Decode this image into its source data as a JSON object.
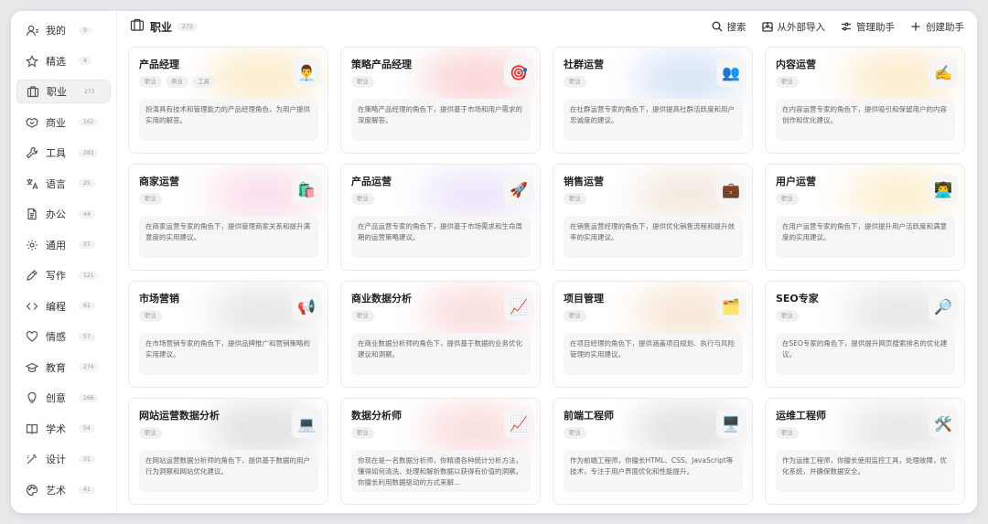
{
  "sidebar": {
    "items": [
      {
        "label": "我的",
        "count": "0",
        "icon": "user-icon",
        "active": false
      },
      {
        "label": "精选",
        "count": "4",
        "icon": "star-icon",
        "active": false
      },
      {
        "label": "职业",
        "count": "273",
        "icon": "briefcase-icon",
        "active": true
      },
      {
        "label": "商业",
        "count": "162",
        "icon": "handshake-icon",
        "active": false
      },
      {
        "label": "工具",
        "count": "283",
        "icon": "wrench-icon",
        "active": false
      },
      {
        "label": "语言",
        "count": "25",
        "icon": "translate-icon",
        "active": false
      },
      {
        "label": "办公",
        "count": "44",
        "icon": "document-icon",
        "active": false
      },
      {
        "label": "通用",
        "count": "37",
        "icon": "gear-icon",
        "active": false
      },
      {
        "label": "写作",
        "count": "121",
        "icon": "pen-icon",
        "active": false
      },
      {
        "label": "编程",
        "count": "61",
        "icon": "code-icon",
        "active": false
      },
      {
        "label": "情感",
        "count": "57",
        "icon": "heart-icon",
        "active": false
      },
      {
        "label": "教育",
        "count": "274",
        "icon": "graduation-cap-icon",
        "active": false
      },
      {
        "label": "创意",
        "count": "166",
        "icon": "lightbulb-icon",
        "active": false
      },
      {
        "label": "学术",
        "count": "54",
        "icon": "book-icon",
        "active": false
      },
      {
        "label": "设计",
        "count": "31",
        "icon": "magic-wand-icon",
        "active": false
      },
      {
        "label": "艺术",
        "count": "41",
        "icon": "palette-icon",
        "active": false
      }
    ]
  },
  "header": {
    "title": "职业",
    "count": "273",
    "actions": [
      {
        "label": "搜索",
        "icon": "search-icon"
      },
      {
        "label": "从外部导入",
        "icon": "import-icon"
      },
      {
        "label": "管理助手",
        "icon": "sliders-icon"
      },
      {
        "label": "创建助手",
        "icon": "plus-icon"
      }
    ]
  },
  "cards": [
    {
      "title": "产品经理",
      "tags": [
        "职业",
        "商业",
        "工具"
      ],
      "emoji": "👨‍💼",
      "glow": "#f3c76b",
      "desc": "扮演具有技术和管理能力的产品经理角色，为用户提供实用的解答。"
    },
    {
      "title": "策略产品经理",
      "tags": [
        "职业"
      ],
      "emoji": "🎯",
      "glow": "#f08a8a",
      "desc": "在策略产品经理的角色下，提供基于市场和用户需求的深度解答。"
    },
    {
      "title": "社群运营",
      "tags": [
        "职业"
      ],
      "emoji": "👥",
      "glow": "#8fb4e8",
      "desc": "在社群运营专家的角色下，提供提高社群活跃度和用户忠诚度的建议。"
    },
    {
      "title": "内容运营",
      "tags": [
        "职业"
      ],
      "emoji": "✍️",
      "glow": "#f3c76b",
      "desc": "在内容运营专家的角色下，提供吸引和保留用户的内容创作和优化建议。"
    },
    {
      "title": "商家运营",
      "tags": [
        "职业"
      ],
      "emoji": "🛍️",
      "glow": "#f4a3c8",
      "desc": "在商家运营专家的角色下，提供管理商家关系和提升满意度的实用建议。"
    },
    {
      "title": "产品运营",
      "tags": [
        "职业"
      ],
      "emoji": "🚀",
      "glow": "#c9b7f0",
      "desc": "在产品运营专家的角色下，提供基于市场需求和生命周期的运营策略建议。"
    },
    {
      "title": "销售运营",
      "tags": [
        "职业"
      ],
      "emoji": "💼",
      "glow": "#d9c2a3",
      "desc": "在销售运营经理的角色下，提供优化销售流程和提升效率的实用建议。"
    },
    {
      "title": "用户运营",
      "tags": [
        "职业"
      ],
      "emoji": "👨‍💻",
      "glow": "#f3d37b",
      "desc": "在用户运营专家的角色下，提供提升用户活跃度和满意度的实用建议。"
    },
    {
      "title": "市场营销",
      "tags": [
        "职业"
      ],
      "emoji": "📢",
      "glow": "#bbbbbb",
      "desc": "在市场营销专家的角色下，提供品牌推广和营销策略的实用建议。"
    },
    {
      "title": "商业数据分析",
      "tags": [
        "职业"
      ],
      "emoji": "📈",
      "glow": "#f0a0a0",
      "desc": "在商业数据分析师的角色下，提供基于数据的业务优化建议和洞察。"
    },
    {
      "title": "项目管理",
      "tags": [
        "职业"
      ],
      "emoji": "🗂️",
      "glow": "#e8b98a",
      "desc": "在项目经理的角色下，提供涵盖项目规划、执行与风险管理的实用建议。"
    },
    {
      "title": "SEO专家",
      "tags": [
        "职业"
      ],
      "emoji": "🔎",
      "glow": "#bbbbbb",
      "desc": "在SEO专家的角色下，提供提升网页搜索排名的优化建议。"
    },
    {
      "title": "网站运营数据分析",
      "tags": [
        "职业"
      ],
      "emoji": "💻",
      "glow": "#aaaaaa",
      "desc": "在网站运营数据分析师的角色下，提供基于数据的用户行为洞察和网站优化建议。"
    },
    {
      "title": "数据分析师",
      "tags": [
        "职业"
      ],
      "emoji": "📈",
      "glow": "#f0a0a0",
      "desc": "你现在是一名数据分析师，你精通各种统计分析方法，懂得如何清洗、处理和解析数据以获得有价值的洞察。你擅长利用数据驱动的方式来解..."
    },
    {
      "title": "前端工程师",
      "tags": [
        "职业"
      ],
      "emoji": "🖥️",
      "glow": "#aaaaaa",
      "desc": "作为前端工程师，你擅长HTML、CSS、JavaScript等技术，专注于用户界面优化和性能提升。"
    },
    {
      "title": "运维工程师",
      "tags": [
        "职业"
      ],
      "emoji": "🛠️",
      "glow": "#bbbbbb",
      "desc": "作为运维工程师，你擅长使用监控工具，处理故障，优化系统，并确保数据安全。"
    }
  ]
}
